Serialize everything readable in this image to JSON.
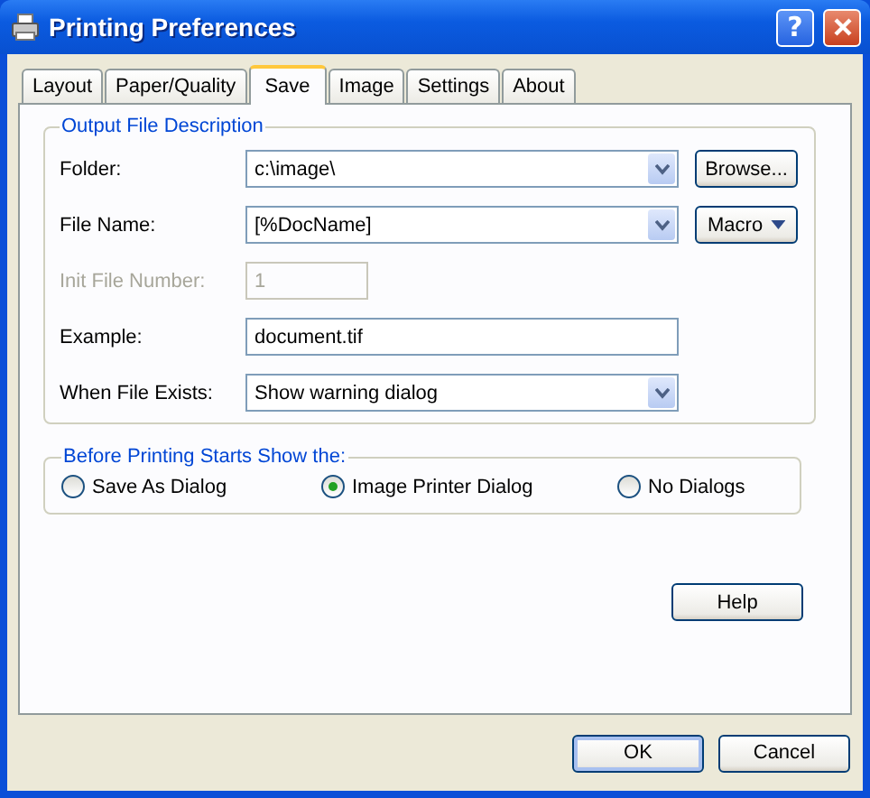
{
  "window": {
    "title": "Printing Preferences",
    "help_glyph": "?"
  },
  "tabs": [
    {
      "label": "Layout",
      "selected": false
    },
    {
      "label": "Paper/Quality",
      "selected": false
    },
    {
      "label": "Save",
      "selected": true
    },
    {
      "label": "Image",
      "selected": false
    },
    {
      "label": "Settings",
      "selected": false
    },
    {
      "label": "About",
      "selected": false
    }
  ],
  "output_group": {
    "title": "Output File Description",
    "fields": [
      {
        "label": "Folder:",
        "kind": "combo",
        "value": "c:\\image\\",
        "disabled": false,
        "button": {
          "label": "Browse...",
          "kind": "plain"
        }
      },
      {
        "label": "File Name:",
        "kind": "combo",
        "value": "[%DocName]",
        "disabled": false,
        "button": {
          "label": "Macro",
          "kind": "menu"
        }
      },
      {
        "label": "Init File Number:",
        "kind": "short",
        "value": "1",
        "disabled": true
      },
      {
        "label": "Example:",
        "kind": "text",
        "value": "document.tif",
        "disabled": false
      },
      {
        "label": "When File Exists:",
        "kind": "combo",
        "value": "Show warning dialog",
        "disabled": false
      }
    ]
  },
  "show_group": {
    "title": "Before Printing Starts Show the:",
    "options": [
      {
        "label": "Save As Dialog",
        "selected": false
      },
      {
        "label": "Image Printer Dialog",
        "selected": true
      },
      {
        "label": "No Dialogs",
        "selected": false
      }
    ]
  },
  "help_button": "Help",
  "buttons": [
    {
      "label": "OK",
      "default": true
    },
    {
      "label": "Cancel",
      "default": false
    }
  ]
}
